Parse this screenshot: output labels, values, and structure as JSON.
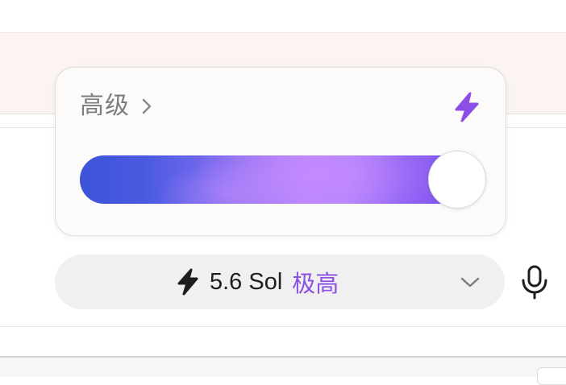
{
  "popover": {
    "title": "高级",
    "level_fraction": 1.0,
    "accent_color": "#8b4fe6"
  },
  "model_selector": {
    "model_name": "5.6 Sol",
    "effort_level": "极高",
    "effort_color": "#8c4fe6"
  },
  "icons": {
    "header_chevron": "chevron-right-icon",
    "popover_bolt": "bolt-icon",
    "pill_bolt": "bolt-icon",
    "pill_chevron": "chevron-down-icon",
    "mic": "microphone-icon"
  }
}
